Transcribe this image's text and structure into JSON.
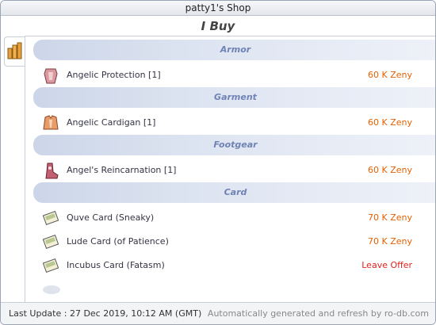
{
  "window": {
    "title": "patty1's Shop"
  },
  "header": {
    "mode": "I Buy"
  },
  "sidebar": {
    "icon": "shop-icon"
  },
  "sections": [
    {
      "label": "Armor",
      "items": [
        {
          "name": "Angelic Protection [1]",
          "price": "60 K Zeny",
          "icon": "armor-icon"
        }
      ]
    },
    {
      "label": "Garment",
      "items": [
        {
          "name": "Angelic Cardigan [1]",
          "price": "60 K Zeny",
          "icon": "garment-icon"
        }
      ]
    },
    {
      "label": "Footgear",
      "items": [
        {
          "name": "Angel's Reincarnation [1]",
          "price": "60 K Zeny",
          "icon": "footgear-icon"
        }
      ]
    },
    {
      "label": "Card",
      "items": [
        {
          "name": "Quve Card (Sneaky)",
          "price": "70 K Zeny",
          "icon": "card-icon"
        },
        {
          "name": "Lude Card (of Patience)",
          "price": "70 K Zeny",
          "icon": "card-icon"
        },
        {
          "name": "Incubus Card (Fatasm)",
          "price": "Leave Offer",
          "icon": "card-icon"
        }
      ]
    }
  ],
  "footer": {
    "last_update": "Last Update : 27 Dec 2019, 10:12 AM (GMT)",
    "credit": "Automatically generated and refresh by ro-db.com"
  },
  "colors": {
    "price": "#e66000",
    "offer": "#e02020",
    "category_text": "#6f83b4"
  }
}
